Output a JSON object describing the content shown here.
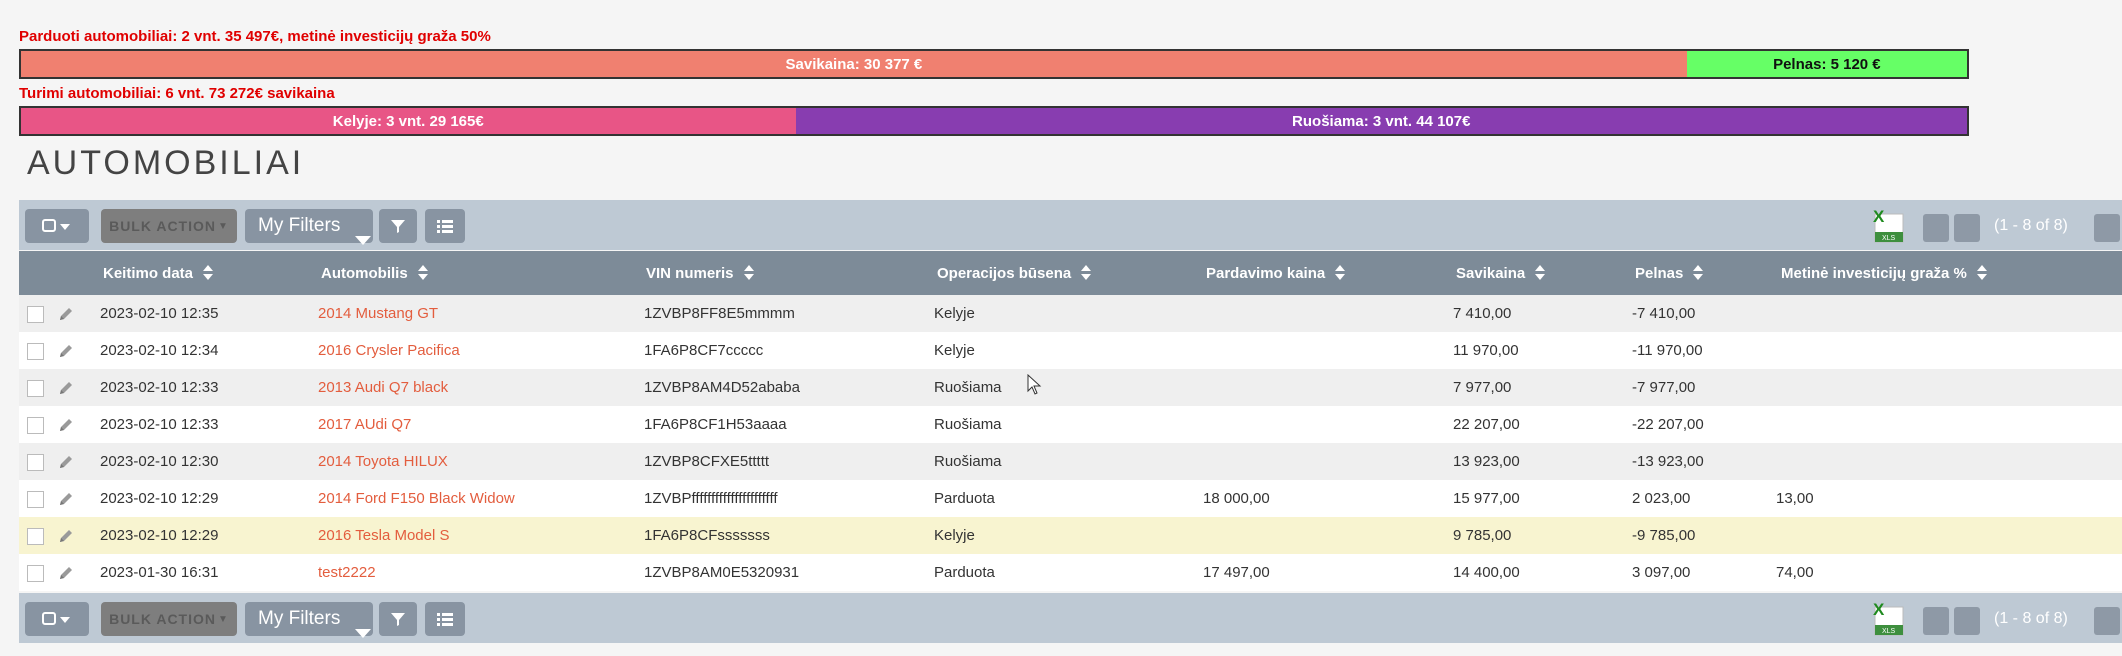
{
  "summary": {
    "sold_text": "Parduoti automobiliai: 2 vnt. 35 497€, metinė investicijų graža 50%",
    "cost_label": "Savikaina: 30 377 €",
    "profit_label": "Pelnas: 5 120 €",
    "owned_text": "Turimi automobiliai: 6 vnt. 73 272€ savikaina",
    "kelyje_label": "Kelyje: 3 vnt. 29 165€",
    "ruosiama_label": "Ruošiama: 3 vnt. 44 107€",
    "colors": {
      "cost": "#f08070",
      "profit": "#66ff66",
      "kelyje": "#e85586",
      "ruosiama": "#883db0"
    },
    "sold_bar_fraction": {
      "cost": 0.856,
      "profit": 0.144
    },
    "owned_bar_fraction": {
      "kelyje": 0.398,
      "ruosiama": 0.602
    }
  },
  "page_title": "AUTOMOBILIAI",
  "toolbar": {
    "bulk_action": "BULK ACTION",
    "my_filters": "My Filters",
    "pagination": "(1 - 8 of 8)",
    "xls_icon": "xls-export-icon"
  },
  "columns": [
    "Keitimo data",
    "Automobilis",
    "VIN numeris",
    "Operacijos būsena",
    "Pardavimo kaina",
    "Savikaina",
    "Pelnas",
    "Metinė investicijų graža %"
  ],
  "rows": [
    {
      "date": "2023-02-10 12:35",
      "car": "2014 Mustang GT",
      "vin": "1ZVBP8FF8E5mmmm",
      "status": "Kelyje",
      "sale_price": "",
      "cost": "7 410,00",
      "profit": "-7 410,00",
      "roi": ""
    },
    {
      "date": "2023-02-10 12:34",
      "car": "2016 Crysler Pacifica",
      "vin": "1FA6P8CF7ccccc",
      "status": "Kelyje",
      "sale_price": "",
      "cost": "11 970,00",
      "profit": "-11 970,00",
      "roi": ""
    },
    {
      "date": "2023-02-10 12:33",
      "car": "2013 Audi Q7 black",
      "vin": "1ZVBP8AM4D52ababa",
      "status": "Ruošiama",
      "sale_price": "",
      "cost": "7 977,00",
      "profit": "-7 977,00",
      "roi": ""
    },
    {
      "date": "2023-02-10 12:33",
      "car": "2017 AUdi Q7",
      "vin": "1FA6P8CF1H53aaaa",
      "status": "Ruošiama",
      "sale_price": "",
      "cost": "22 207,00",
      "profit": "-22 207,00",
      "roi": ""
    },
    {
      "date": "2023-02-10 12:30",
      "car": "2014 Toyota HILUX",
      "vin": "1ZVBP8CFXE5ttttt",
      "status": "Ruošiama",
      "sale_price": "",
      "cost": "13 923,00",
      "profit": "-13 923,00",
      "roi": ""
    },
    {
      "date": "2023-02-10 12:29",
      "car": "2014 Ford F150 Black Widow",
      "vin": "1ZVBPffffffffffffffffffffff",
      "status": "Parduota",
      "sale_price": "18 000,00",
      "cost": "15 977,00",
      "profit": "2 023,00",
      "roi": "13,00"
    },
    {
      "date": "2023-02-10 12:29",
      "car": "2016 Tesla Model S",
      "vin": "1FA6P8CFsssssss",
      "status": "Kelyje",
      "sale_price": "",
      "cost": "9 785,00",
      "profit": "-9 785,00",
      "roi": ""
    },
    {
      "date": "2023-01-30 16:31",
      "car": "test2222",
      "vin": "1ZVBP8AM0E5320931",
      "status": "Parduota",
      "sale_price": "17 497,00",
      "cost": "14 400,00",
      "profit": "3 097,00",
      "roi": "74,00"
    }
  ]
}
